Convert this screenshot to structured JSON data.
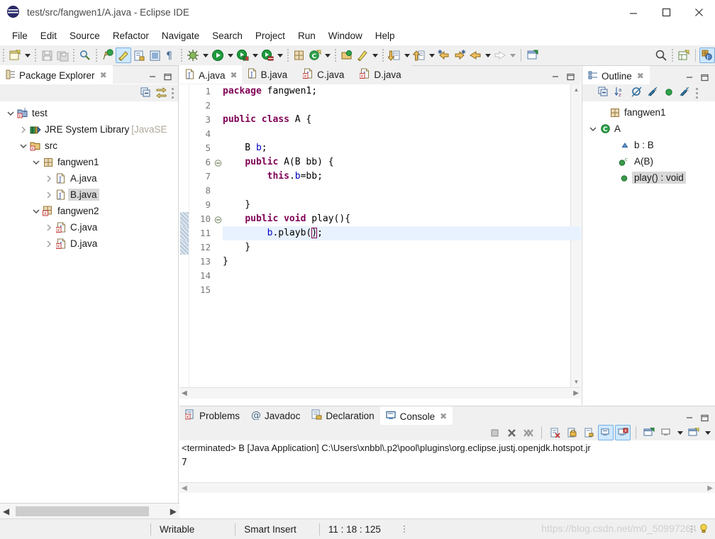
{
  "window": {
    "title": "test/src/fangwen1/A.java - Eclipse IDE",
    "icon": "eclipse-globe-icon",
    "minimize_label": "—",
    "maximize_label": "☐",
    "close_label": "✕"
  },
  "menubar": {
    "items": [
      "File",
      "Edit",
      "Source",
      "Refactor",
      "Navigate",
      "Search",
      "Project",
      "Run",
      "Window",
      "Help"
    ]
  },
  "toolbar": {
    "groups": [
      {
        "items": [
          {
            "name": "new-wizard-icon",
            "glyph": "new"
          },
          {
            "name": "new-wizard-dropdown",
            "glyph": "arrow"
          }
        ]
      },
      {
        "items": [
          {
            "name": "save-icon",
            "glyph": "save"
          },
          {
            "name": "save-all-icon",
            "glyph": "saveall"
          }
        ]
      },
      {
        "items": [
          {
            "name": "link-editor-icon",
            "glyph": "pin"
          }
        ]
      },
      {
        "items": [
          {
            "name": "quick-access-icon",
            "glyph": "greencirc"
          },
          {
            "name": "toggle-markup-icon",
            "glyph": "pencil",
            "selected": true
          },
          {
            "name": "open-declaration-icon",
            "glyph": "doc"
          },
          {
            "name": "block-selection-icon",
            "glyph": "block"
          },
          {
            "name": "show-whitespace-icon",
            "glyph": "pilcrow"
          }
        ]
      },
      {
        "items": [
          {
            "name": "debug-icon",
            "glyph": "bug"
          },
          {
            "name": "debug-dropdown",
            "glyph": "arrow"
          },
          {
            "name": "run-icon",
            "glyph": "run"
          },
          {
            "name": "run-dropdown",
            "glyph": "arrow"
          },
          {
            "name": "run-external-tools-icon",
            "glyph": "runext"
          },
          {
            "name": "run-external-dropdown",
            "glyph": "arrow"
          },
          {
            "name": "coverage-icon",
            "glyph": "coverage"
          },
          {
            "name": "coverage-dropdown",
            "glyph": "arrow"
          }
        ]
      },
      {
        "items": [
          {
            "name": "new-java-package-icon",
            "glyph": "pkgnew"
          },
          {
            "name": "new-java-class-icon",
            "glyph": "classnew"
          },
          {
            "name": "new-class-dropdown",
            "glyph": "arrow"
          }
        ]
      },
      {
        "items": [
          {
            "name": "open-type-icon",
            "glyph": "opentype"
          },
          {
            "name": "search-ref-icon",
            "glyph": "pen"
          },
          {
            "name": "search-dropdown",
            "glyph": "arrow"
          }
        ]
      },
      {
        "items": [
          {
            "name": "next-annotation-icon",
            "glyph": "down"
          },
          {
            "name": "next-annotation-dropdown",
            "glyph": "arrow"
          },
          {
            "name": "previous-annotation-icon",
            "glyph": "up"
          },
          {
            "name": "previous-annotation-dropdown",
            "glyph": "arrow"
          },
          {
            "name": "last-edit-location-icon",
            "glyph": "backstar"
          },
          {
            "name": "next-edit-location-icon",
            "glyph": "fwdstar"
          },
          {
            "name": "back-icon",
            "glyph": "back"
          },
          {
            "name": "back-dropdown",
            "glyph": "arrow"
          },
          {
            "name": "forward-icon",
            "glyph": "fwd",
            "disabled": true
          },
          {
            "name": "forward-dropdown",
            "glyph": "arrow",
            "disabled": true
          }
        ]
      },
      {
        "items": [
          {
            "name": "new-window-icon",
            "glyph": "newwin"
          }
        ]
      }
    ],
    "right": [
      {
        "name": "search-icon",
        "glyph": "magnifier"
      },
      {
        "name": "open-perspective-icon",
        "glyph": "persp"
      },
      {
        "name": "java-perspective-icon",
        "glyph": "javapersp",
        "selected": true
      }
    ]
  },
  "package_explorer": {
    "tab_label": "Package Explorer",
    "tab_icon": "package-explorer-icon",
    "close_label": "✖",
    "view_menu_icon": "view-menu-icon",
    "minimize_icon": "minimize-icon",
    "maximize_icon": "maximize-icon",
    "toolbar": [
      {
        "name": "collapse-all-icon"
      },
      {
        "name": "link-with-editor-icon"
      },
      {
        "name": "view-menu-icon"
      }
    ],
    "tree": [
      {
        "depth": 0,
        "twist": "open",
        "icon": "java-project-icon",
        "label": "test",
        "suffix": ""
      },
      {
        "depth": 1,
        "twist": "closed",
        "icon": "jre-library-icon",
        "label": "JRE System Library",
        "suffix": " [JavaSE"
      },
      {
        "depth": 1,
        "twist": "open",
        "icon": "source-folder-icon",
        "label": "src",
        "suffix": ""
      },
      {
        "depth": 2,
        "twist": "open",
        "icon": "package-icon",
        "label": "fangwen1",
        "suffix": ""
      },
      {
        "depth": 3,
        "twist": "closed",
        "icon": "java-file-icon",
        "label": "A.java",
        "suffix": ""
      },
      {
        "depth": 3,
        "twist": "closed",
        "icon": "java-file-icon",
        "label": "B.java",
        "suffix": "",
        "selected": true
      },
      {
        "depth": 2,
        "twist": "open",
        "icon": "package-error-icon",
        "label": "fangwen2",
        "suffix": ""
      },
      {
        "depth": 3,
        "twist": "closed",
        "icon": "java-file-error-icon",
        "label": "C.java",
        "suffix": ""
      },
      {
        "depth": 3,
        "twist": "closed",
        "icon": "java-file-error-icon",
        "label": "D.java",
        "suffix": ""
      }
    ]
  },
  "editor": {
    "tabs": [
      {
        "label": "A.java",
        "icon": "java-file-icon",
        "active": true,
        "close_label": "✖"
      },
      {
        "label": "B.java",
        "icon": "java-file-icon",
        "active": false,
        "close_label": ""
      },
      {
        "label": "C.java",
        "icon": "java-file-error-icon",
        "active": false,
        "close_label": ""
      },
      {
        "label": "D.java",
        "icon": "java-file-error-icon",
        "active": false,
        "close_label": ""
      }
    ],
    "minimize_icon": "minimize-icon",
    "maximize_icon": "maximize-icon",
    "highlight_line": 11,
    "lines": [
      {
        "num": 1,
        "fold": "",
        "tokens": [
          {
            "t": "package",
            "c": "kw"
          },
          {
            "t": " fangwen1;",
            "c": "pl"
          }
        ]
      },
      {
        "num": 2,
        "fold": "",
        "tokens": []
      },
      {
        "num": 3,
        "fold": "",
        "tokens": [
          {
            "t": "public class",
            "c": "kw"
          },
          {
            "t": " A {",
            "c": "pl"
          }
        ]
      },
      {
        "num": 4,
        "fold": "",
        "tokens": []
      },
      {
        "num": 5,
        "fold": "",
        "tokens": [
          {
            "t": "    B ",
            "c": "pl"
          },
          {
            "t": "b",
            "c": "fld"
          },
          {
            "t": ";",
            "c": "pl"
          }
        ]
      },
      {
        "num": 6,
        "fold": "minus",
        "tokens": [
          {
            "t": "    ",
            "c": "pl"
          },
          {
            "t": "public",
            "c": "kw"
          },
          {
            "t": " A(B bb) {",
            "c": "pl"
          }
        ]
      },
      {
        "num": 7,
        "fold": "",
        "tokens": [
          {
            "t": "        ",
            "c": "pl"
          },
          {
            "t": "this",
            "c": "kw"
          },
          {
            "t": ".",
            "c": "pl"
          },
          {
            "t": "b",
            "c": "fld"
          },
          {
            "t": "=bb;",
            "c": "pl"
          }
        ]
      },
      {
        "num": 8,
        "fold": "",
        "tokens": []
      },
      {
        "num": 9,
        "fold": "",
        "tokens": [
          {
            "t": "    }",
            "c": "pl"
          }
        ]
      },
      {
        "num": 10,
        "fold": "minus",
        "tokens": [
          {
            "t": "    ",
            "c": "pl"
          },
          {
            "t": "public void",
            "c": "kw"
          },
          {
            "t": " play(){",
            "c": "pl"
          }
        ]
      },
      {
        "num": 11,
        "fold": "",
        "tokens": [
          {
            "t": "        ",
            "c": "pl"
          },
          {
            "t": "b",
            "c": "fld"
          },
          {
            "t": ".playb(",
            "c": "pl"
          },
          {
            "t": ")",
            "c": "brk"
          },
          {
            "t": ";",
            "c": "pl"
          }
        ]
      },
      {
        "num": 12,
        "fold": "",
        "tokens": [
          {
            "t": "    }",
            "c": "pl"
          }
        ]
      },
      {
        "num": 13,
        "fold": "",
        "tokens": [
          {
            "t": "}",
            "c": "pl"
          }
        ]
      },
      {
        "num": 14,
        "fold": "",
        "tokens": []
      },
      {
        "num": 15,
        "fold": "",
        "tokens": []
      }
    ]
  },
  "outline": {
    "tab_label": "Outline",
    "tab_icon": "outline-icon",
    "close_label": "✖",
    "minimize_icon": "minimize-icon",
    "maximize_icon": "maximize-icon",
    "toolbar": [
      {
        "name": "collapse-all-icon"
      },
      {
        "name": "sort-icon"
      },
      {
        "name": "hide-fields-icon"
      },
      {
        "name": "hide-static-icon"
      },
      {
        "name": "hide-non-public-icon"
      },
      {
        "name": "hide-local-types-icon"
      },
      {
        "name": "view-menu-icon"
      }
    ],
    "tree": [
      {
        "depth": 1,
        "twist": "",
        "icon": "package-icon",
        "label": "fangwen1",
        "selected": false
      },
      {
        "depth": 0,
        "twist": "open",
        "icon": "class-icon",
        "label": "A",
        "selected": false
      },
      {
        "depth": 2,
        "twist": "",
        "icon": "field-icon",
        "label": "b : B",
        "selected": false
      },
      {
        "depth": 2,
        "twist": "",
        "icon": "ctor-icon",
        "label": "A(B)",
        "selected": false
      },
      {
        "depth": 2,
        "twist": "",
        "icon": "method-icon",
        "label": "play() : void",
        "selected": true
      }
    ]
  },
  "console": {
    "tabs": [
      {
        "label": "Problems",
        "icon": "problems-icon",
        "active": false
      },
      {
        "label": "Javadoc",
        "icon": "javadoc-icon",
        "active": false
      },
      {
        "label": "Declaration",
        "icon": "declaration-icon",
        "active": false
      },
      {
        "label": "Console",
        "icon": "console-icon",
        "active": true,
        "close_label": "✖"
      }
    ],
    "minimize_icon": "minimize-icon",
    "maximize_icon": "maximize-icon",
    "toolbar": [
      {
        "name": "terminate-icon"
      },
      {
        "name": "remove-launch-icon"
      },
      {
        "name": "remove-all-launches-icon"
      },
      {
        "name": "clear-console-icon"
      },
      {
        "name": "scroll-lock-icon"
      },
      {
        "name": "word-wrap-icon"
      },
      {
        "name": "show-console-on-output-icon",
        "selected": true
      },
      {
        "name": "show-console-on-error-icon",
        "selected": true
      },
      {
        "name": "pin-console-icon"
      },
      {
        "name": "display-selected-console-icon"
      },
      {
        "name": "display-console-dropdown"
      },
      {
        "name": "open-console-icon"
      },
      {
        "name": "open-console-dropdown"
      }
    ],
    "header_line": "<terminated> B [Java Application] C:\\Users\\xnbbl\\.p2\\pool\\plugins\\org.eclipse.justj.openjdk.hotspot.jr",
    "output_lines": [
      "7"
    ]
  },
  "statusbar": {
    "writable": "Writable",
    "insert_mode": "Smart Insert",
    "cursor_position": "11 : 18 : 125",
    "watermark": "https://blog.csdn.net/m0_50997264"
  },
  "colors": {
    "keyword": "#7f0055",
    "field": "#0000c0",
    "line_highlight": "#e8f2fe",
    "selection": "#d8d8d8",
    "panel_bg": "#f0f0f0",
    "tab_selected_border": "#cde8ff"
  }
}
